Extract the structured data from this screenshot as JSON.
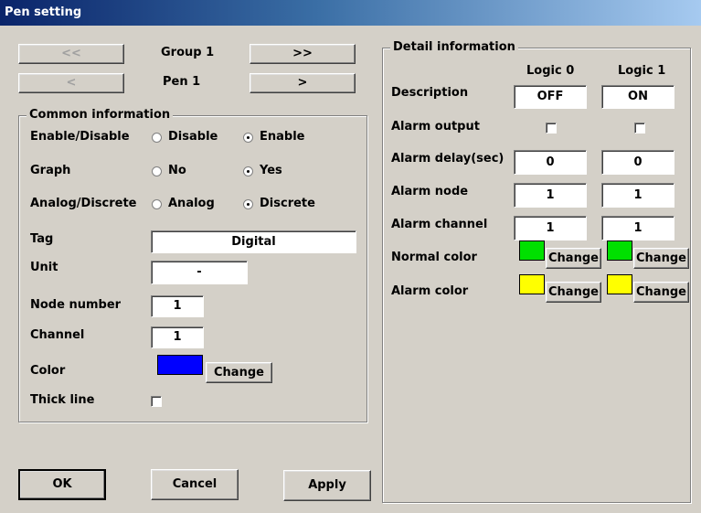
{
  "window": {
    "title": "Pen setting"
  },
  "nav": {
    "group_prev": "<<",
    "group_label": "Group 1",
    "group_next": ">>",
    "pen_prev": "<",
    "pen_label": "Pen 1",
    "pen_next": ">"
  },
  "common": {
    "legend": "Common information",
    "enable_label": "Enable/Disable",
    "enable_options": [
      "Disable",
      "Enable"
    ],
    "enable_selected": "Enable",
    "graph_label": "Graph",
    "graph_options": [
      "No",
      "Yes"
    ],
    "graph_selected": "Yes",
    "type_label": "Analog/Discrete",
    "type_options": [
      "Analog",
      "Discrete"
    ],
    "type_selected": "Discrete",
    "tag_label": "Tag",
    "tag_value": "Digital",
    "unit_label": "Unit",
    "unit_value": "-",
    "node_label": "Node number",
    "node_value": "1",
    "channel_label": "Channel",
    "channel_value": "1",
    "color_label": "Color",
    "color_value": "#0000ff",
    "color_button": "Change",
    "thick_label": "Thick line",
    "thick_checked": false
  },
  "detail": {
    "legend": "Detail information",
    "col_headers": [
      "Logic 0",
      "Logic 1"
    ],
    "description_label": "Description",
    "description_values": [
      "OFF",
      "ON"
    ],
    "alarm_output_label": "Alarm output",
    "alarm_output_checked": [
      false,
      false
    ],
    "alarm_delay_label": "Alarm delay(sec)",
    "alarm_delay_values": [
      "0",
      "0"
    ],
    "alarm_node_label": "Alarm node",
    "alarm_node_values": [
      "1",
      "1"
    ],
    "alarm_channel_label": "Alarm channel",
    "alarm_channel_values": [
      "1",
      "1"
    ],
    "normal_color_label": "Normal color",
    "normal_colors": [
      "#00e000",
      "#00e000"
    ],
    "alarm_color_label": "Alarm color",
    "alarm_colors": [
      "#ffff00",
      "#ffff00"
    ],
    "change_label": "Change"
  },
  "footer": {
    "ok": "OK",
    "cancel": "Cancel",
    "apply": "Apply"
  }
}
